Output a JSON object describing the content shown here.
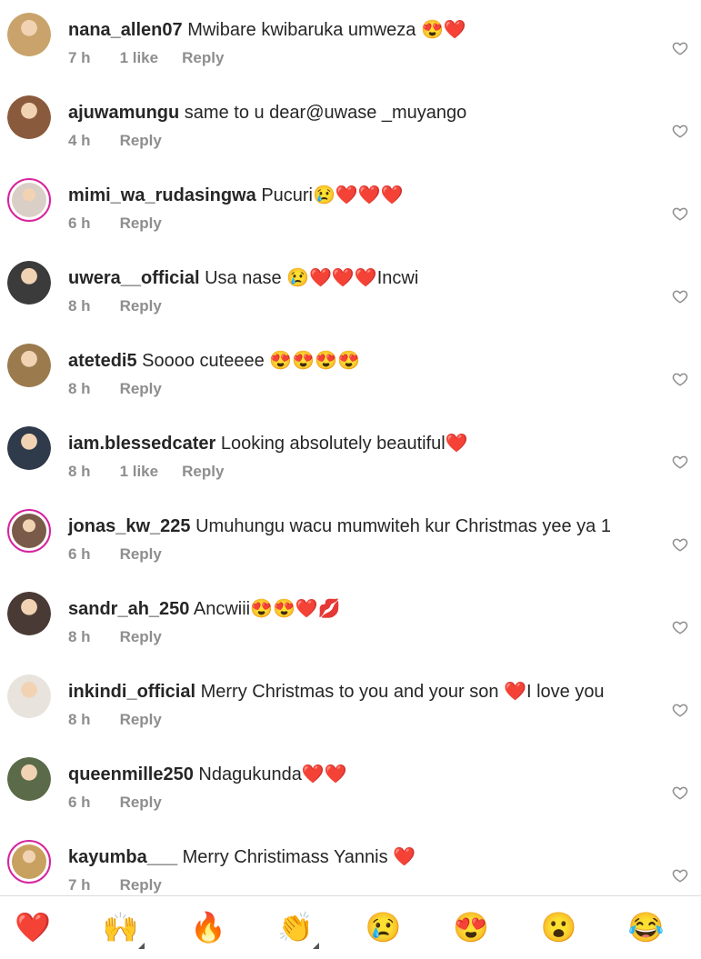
{
  "comments": [
    {
      "user": "nana_allen07",
      "text": "Mwibare kwibaruka umweza 😍❤️",
      "time": "7 h",
      "likes": "1 like",
      "reply": "Reply",
      "ring": false,
      "avatar_color": "#c9a36b"
    },
    {
      "user": "ajuwamungu",
      "text": "same to u dear@uwase _muyango",
      "time": "4 h",
      "likes": "",
      "reply": "Reply",
      "ring": false,
      "avatar_color": "#8a5a3c"
    },
    {
      "user": "mimi_wa_rudasingwa",
      "text": "Pucuri😢❤️❤️❤️",
      "time": "6 h",
      "likes": "",
      "reply": "Reply",
      "ring": true,
      "avatar_color": "#d9cfc6"
    },
    {
      "user": "uwera__official",
      "text": "Usa nase 😢❤️❤️❤️Incwi",
      "time": "8 h",
      "likes": "",
      "reply": "Reply",
      "ring": false,
      "avatar_color": "#3b3b3b"
    },
    {
      "user": "atetedi5",
      "text": "Soooo cuteeee 😍😍😍😍",
      "time": "8 h",
      "likes": "",
      "reply": "Reply",
      "ring": false,
      "avatar_color": "#9b7a4e"
    },
    {
      "user": "iam.blessedcater",
      "text": "Looking absolutely beautiful❤️",
      "time": "8 h",
      "likes": "1 like",
      "reply": "Reply",
      "ring": false,
      "avatar_color": "#2f3a4a"
    },
    {
      "user": "jonas_kw_225",
      "text": "Umuhungu wacu mumwiteh kur Christmas yee ya 1",
      "time": "6 h",
      "likes": "",
      "reply": "Reply",
      "ring": true,
      "avatar_color": "#7a5a48"
    },
    {
      "user": "sandr_ah_250",
      "text": "Ancwiii😍😍❤️💋",
      "time": "8 h",
      "likes": "",
      "reply": "Reply",
      "ring": false,
      "avatar_color": "#4a3a36"
    },
    {
      "user": "inkindi_official",
      "text": "Merry Christmas to you and your son ❤️I love you",
      "time": "8 h",
      "likes": "",
      "reply": "Reply",
      "ring": false,
      "avatar_color": "#e8e3dc"
    },
    {
      "user": "queenmille250",
      "text": "Ndagukunda❤️❤️",
      "time": "6 h",
      "likes": "",
      "reply": "Reply",
      "ring": false,
      "avatar_color": "#5b6b4a"
    },
    {
      "user": "kayumba___",
      "text": "Merry Christimass Yannis ❤️",
      "time": "7 h",
      "likes": "",
      "reply": "Reply",
      "ring": true,
      "avatar_color": "#c8a060"
    }
  ],
  "reactions": [
    {
      "emoji": "❤️",
      "name": "red-heart-icon",
      "corner": false
    },
    {
      "emoji": "🙌",
      "name": "raising-hands-icon",
      "corner": true
    },
    {
      "emoji": "🔥",
      "name": "fire-icon",
      "corner": false
    },
    {
      "emoji": "👏",
      "name": "clapping-hands-icon",
      "corner": true
    },
    {
      "emoji": "😢",
      "name": "crying-face-icon",
      "corner": false
    },
    {
      "emoji": "😍",
      "name": "heart-eyes-icon",
      "corner": false
    },
    {
      "emoji": "😮",
      "name": "surprised-face-icon",
      "corner": false
    },
    {
      "emoji": "😂",
      "name": "tears-of-joy-icon",
      "corner": false
    }
  ]
}
